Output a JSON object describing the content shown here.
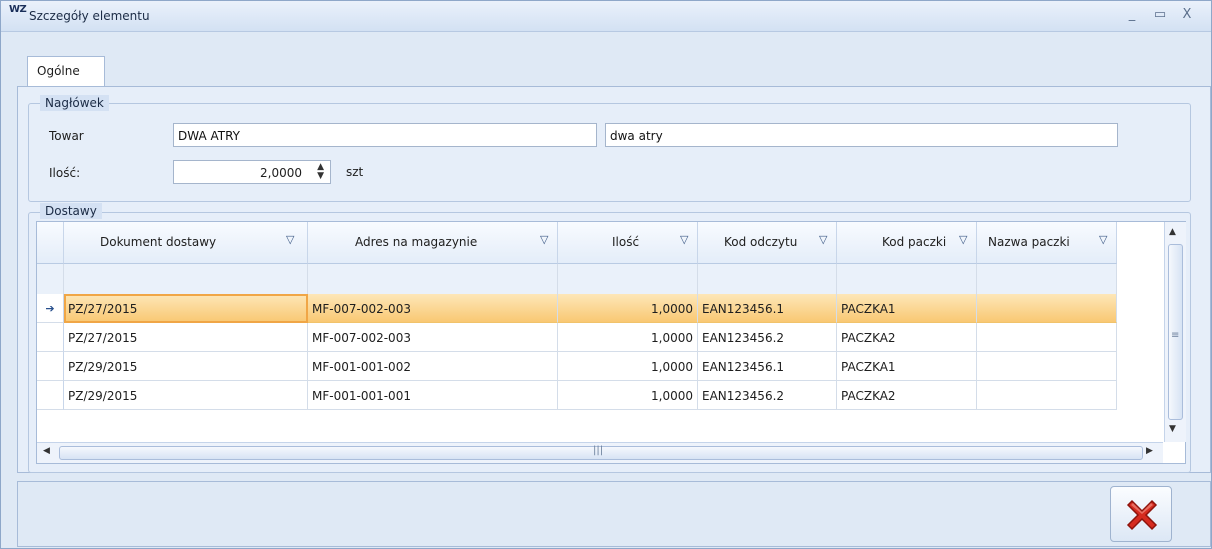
{
  "window": {
    "app_icon": "WZ",
    "title": "Szczegóły elementu",
    "controls": {
      "minimize": "_",
      "maximize": "▭",
      "close": "X"
    }
  },
  "tabs": [
    {
      "label": "Ogólne",
      "active": true
    }
  ],
  "header_group": {
    "legend": "Nagłówek",
    "towar_label": "Towar",
    "towar_code": "DWA ATRY",
    "towar_name": "dwa atry",
    "ilosc_label": "Ilość:",
    "ilosc_value": "2,0000",
    "unit": "szt"
  },
  "deliveries_group": {
    "legend": "Dostawy",
    "columns": [
      "Dokument dostawy",
      "Adres na magazynie",
      "Ilość",
      "Kod odczytu",
      "Kod paczki",
      "Nazwa paczki"
    ],
    "rows": [
      [
        "PZ/27/2015",
        "MF-007-002-003",
        "1,0000",
        "EAN123456.1",
        "PACZKA1",
        ""
      ],
      [
        "PZ/27/2015",
        "MF-007-002-003",
        "1,0000",
        "EAN123456.2",
        "PACZKA2",
        ""
      ],
      [
        "PZ/29/2015",
        "MF-001-001-002",
        "1,0000",
        "EAN123456.1",
        "PACZKA1",
        ""
      ],
      [
        "PZ/29/2015",
        "MF-001-001-001",
        "1,0000",
        "EAN123456.2",
        "PACZKA2",
        ""
      ]
    ],
    "selected_row": 0,
    "row_indicator": "➔"
  },
  "icons": {
    "filter": "filter-icon",
    "close_button": "red-x-icon"
  },
  "colors": {
    "selection": "#f9c873",
    "close_red": "#d62b1f"
  }
}
